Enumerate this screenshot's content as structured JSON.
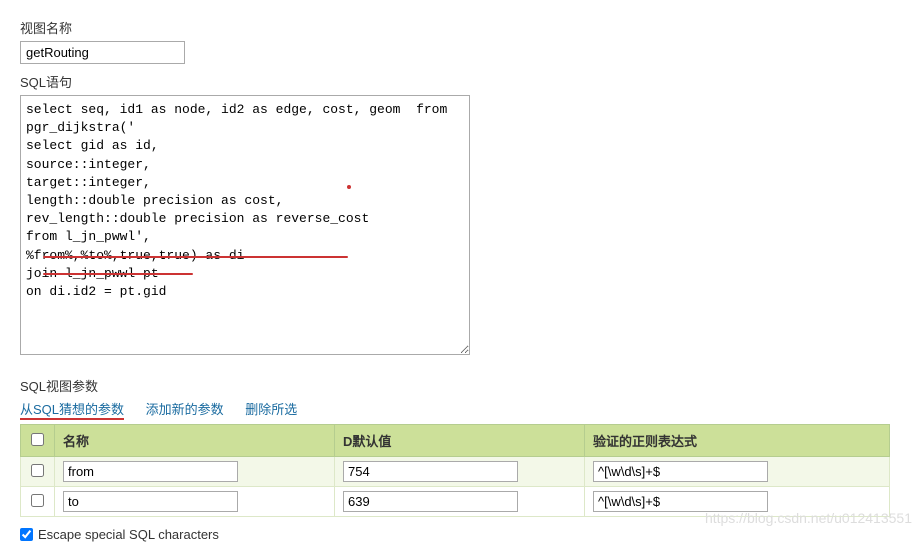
{
  "viewName": {
    "label": "视图名称",
    "value": "getRouting"
  },
  "sqlStatement": {
    "label": "SQL语句",
    "value": "select seq, id1 as node, id2 as edge, cost, geom  from\npgr_dijkstra('\nselect gid as id,\nsource::integer,\ntarget::integer,\nlength::double precision as cost,\nrev_length::double precision as reverse_cost\nfrom l_jn_pwwl',\n%from%,%to%,true,true) as di\njoin l_jn_pwwl pt\non di.id2 = pt.gid"
  },
  "sqlViewParams": {
    "label": "SQL视图参数",
    "links": {
      "guess": "从SQL猜想的参数",
      "addNew": "添加新的参数",
      "deleteSelected": "删除所选"
    },
    "headers": {
      "name": "名称",
      "defaultValue": "D默认值",
      "regex": "验证的正则表达式"
    },
    "rows": [
      {
        "name": "from",
        "defaultValue": "754",
        "regex": "^[\\w\\d\\s]+$"
      },
      {
        "name": "to",
        "defaultValue": "639",
        "regex": "^[\\w\\d\\s]+$"
      }
    ]
  },
  "escapeChars": {
    "label": "Escape special SQL characters",
    "checked": true
  },
  "watermark": "https://blog.csdn.net/u012413551"
}
